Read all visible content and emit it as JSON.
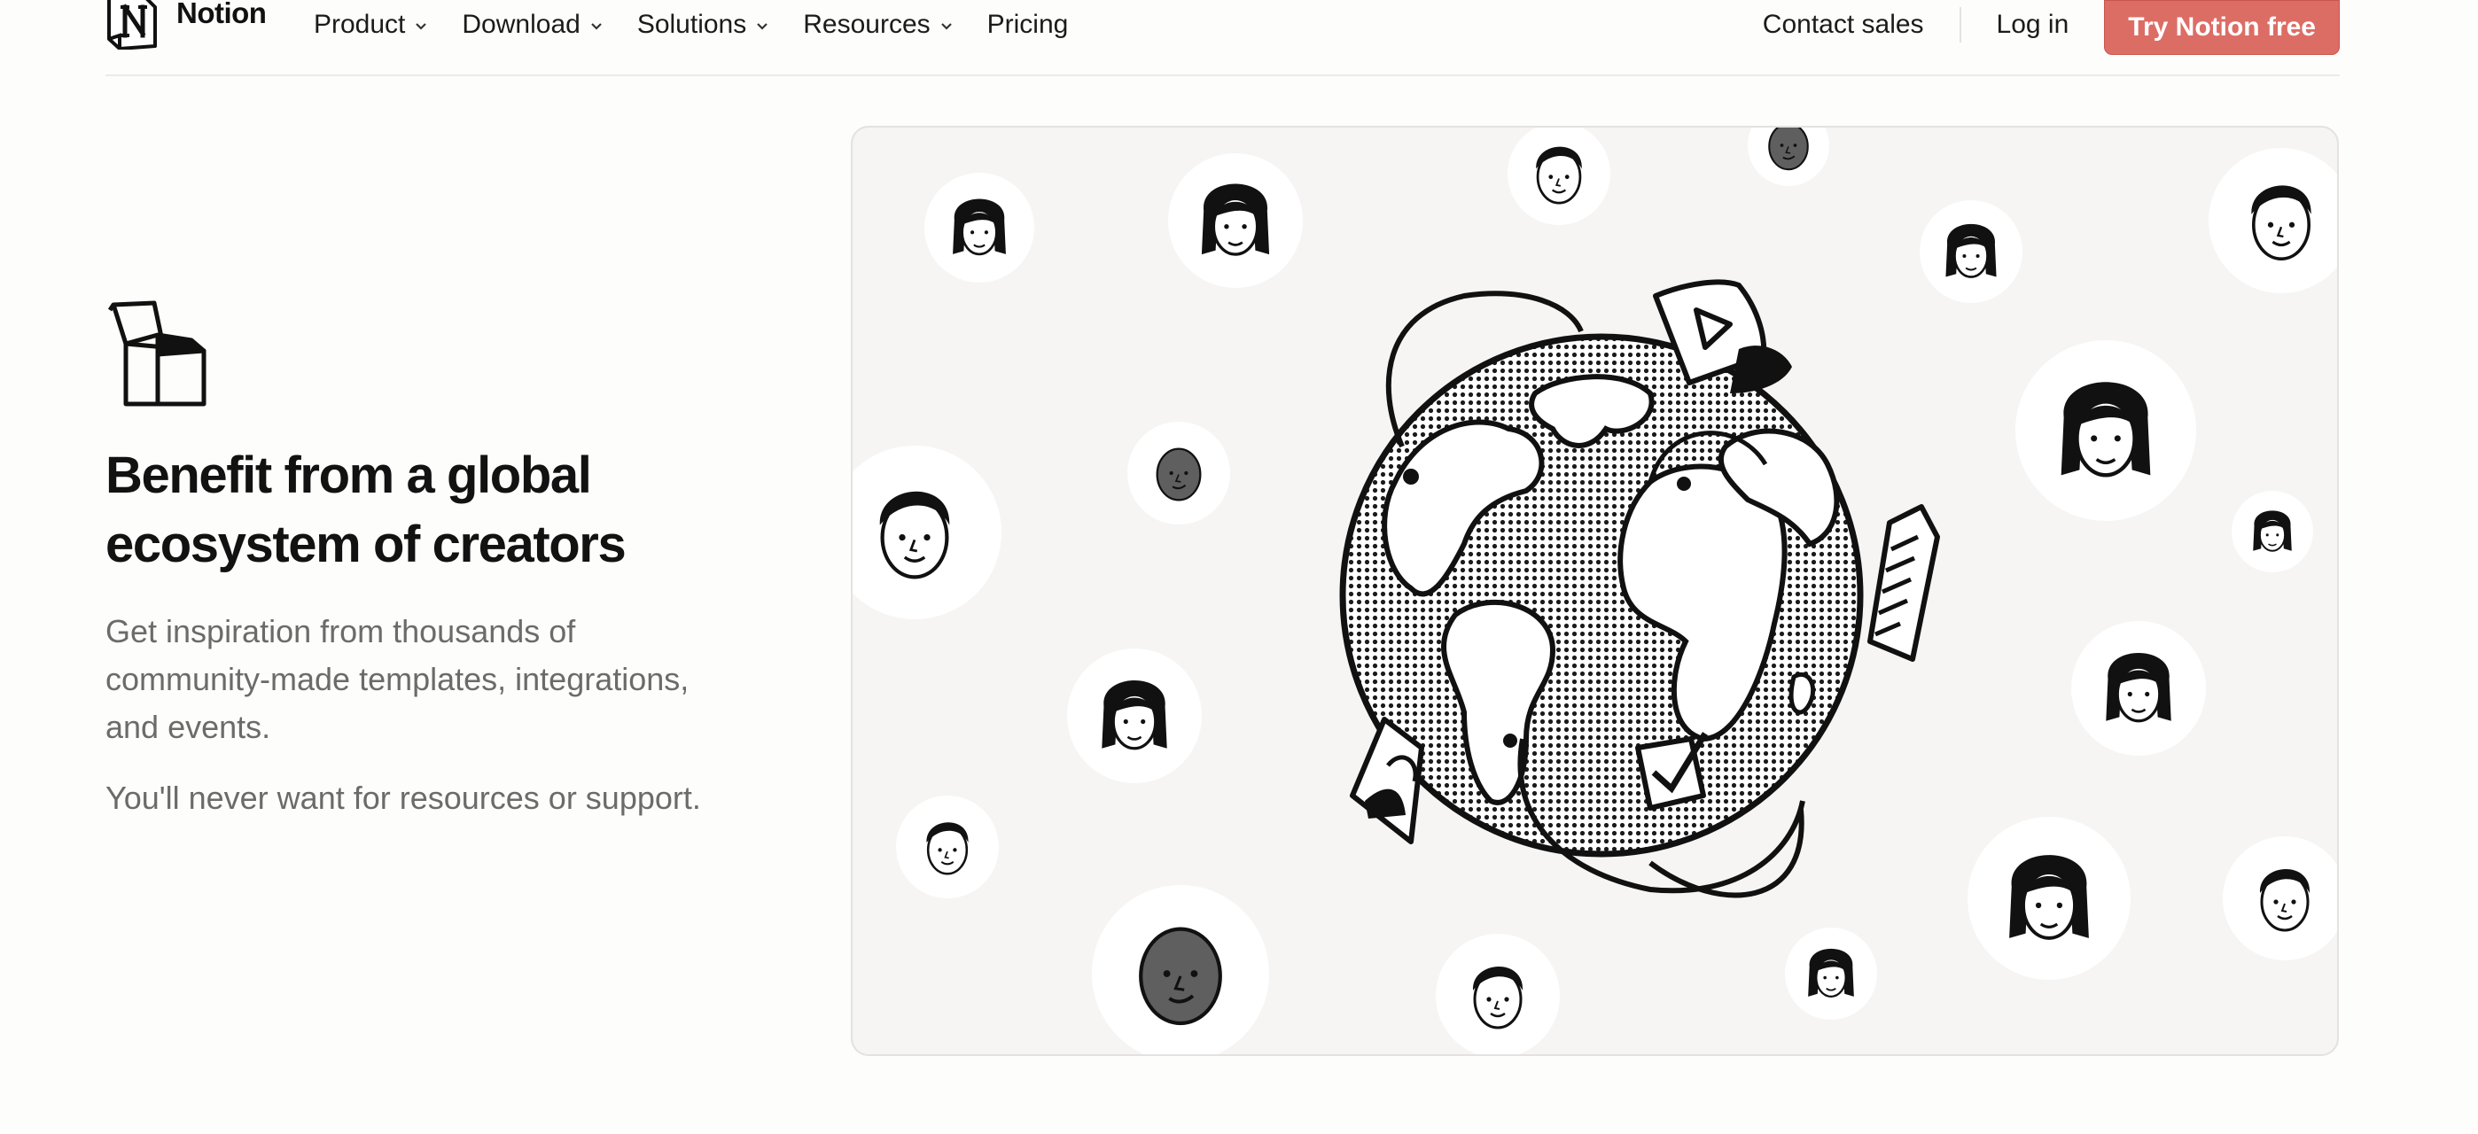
{
  "brand": {
    "name": "Notion"
  },
  "nav": {
    "items": [
      {
        "label": "Product",
        "has_dropdown": true
      },
      {
        "label": "Download",
        "has_dropdown": true
      },
      {
        "label": "Solutions",
        "has_dropdown": true
      },
      {
        "label": "Resources",
        "has_dropdown": true
      },
      {
        "label": "Pricing",
        "has_dropdown": false
      }
    ],
    "contact_sales": "Contact sales",
    "log_in": "Log in",
    "try_free": "Try Notion free"
  },
  "hero": {
    "icon": "open-box-icon",
    "headline_line1": "Benefit from a global",
    "headline_line2": "ecosystem of creators",
    "body_line1": "Get inspiration from thousands of",
    "body_line2": "community-made templates, integrations,",
    "body_line3": "and events.",
    "body_2": "You'll never want for resources or support."
  },
  "illustration": {
    "name": "globe-with-community-faces-illustration",
    "accent_button_color": "#dc6d65"
  }
}
